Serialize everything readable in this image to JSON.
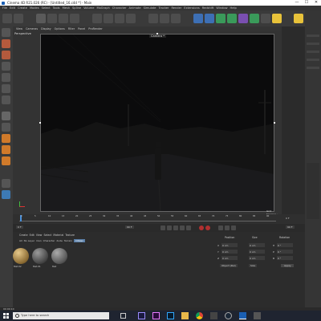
{
  "window": {
    "title": "Cinema 4D R21.026 (RC) - [Untitled_16.c4d *] - Main",
    "minimize": "—",
    "maximize": "☐",
    "close": "✕"
  },
  "menu": [
    "File",
    "Edit",
    "Create",
    "Modes",
    "Select",
    "Tools",
    "Mesh",
    "Spline",
    "Volume",
    "MoGraph",
    "Character",
    "Animate",
    "Simulate",
    "Tracker",
    "Render",
    "Extensions",
    "Redshift",
    "Window",
    "Help"
  ],
  "viewport": {
    "menu": [
      "View",
      "Cameras",
      "Display",
      "Options",
      "Filter",
      "Panel",
      "ProRender"
    ],
    "label": "Perspective",
    "camera": "Camera *",
    "grid": "Grid Spacing : 10000 cm"
  },
  "timeline": {
    "ticks": [
      "0",
      "5",
      "10",
      "15",
      "20",
      "25",
      "30",
      "35",
      "40",
      "45",
      "50",
      "55",
      "60",
      "65",
      "70",
      "75",
      "80",
      "85",
      "90"
    ],
    "frame": "0 F",
    "start": "0 F",
    "end": "90 F",
    "end2": "90 F"
  },
  "materials": {
    "menu": [
      "Create",
      "Edit",
      "View",
      "Select",
      "Material",
      "Texture"
    ],
    "tabs": [
      "All",
      "No Layer",
      "man",
      "Character",
      "dude",
      "Terrain",
      "Citizen"
    ],
    "active_tab": "Citizen",
    "items": [
      {
        "name": "Mat.02"
      },
      {
        "name": "Mat.01"
      },
      {
        "name": "Mat"
      }
    ]
  },
  "attributes": {
    "headers": [
      "Position",
      "Size",
      "Rotation"
    ],
    "rows": [
      {
        "axis": "X",
        "pos": "0 cm",
        "size": "0 cm",
        "rlabel": "H",
        "rot": "0 °"
      },
      {
        "axis": "Y",
        "pos": "0 cm",
        "size": "0 cm",
        "rlabel": "P",
        "rot": "0 °"
      },
      {
        "axis": "Z",
        "pos": "0 cm",
        "size": "0 cm",
        "rlabel": "B",
        "rot": "0 °"
      }
    ],
    "mode": "Object (Rel)",
    "size_mode": "Size",
    "apply": "Apply"
  },
  "status": "00:00:10",
  "taskbar": {
    "search": "Type here to search"
  }
}
